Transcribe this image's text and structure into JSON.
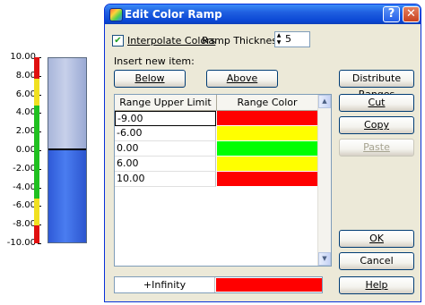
{
  "gauge": {
    "labels": [
      "10.00",
      "8.00",
      "6.00",
      "4.00",
      "2.00",
      "0.00",
      "-2.00",
      "-4.00",
      "-6.00",
      "-8.00",
      "-10.00"
    ],
    "level": 0.5,
    "colors": {
      "red": "#e01010",
      "yellow": "#f0e020",
      "green": "#20c020"
    }
  },
  "dialog": {
    "title": "Edit Color Ramp",
    "help_glyph": "?",
    "close_glyph": "✕",
    "interpolate_label": "Interpolate Colors",
    "interpolate_checked_glyph": "✔",
    "ramp_thickness_label": "Ramp Thickness:",
    "ramp_thickness_value": "5",
    "insert_label": "Insert new item:",
    "below_label": "Below",
    "above_label": "Above",
    "distribute_label": "Distribute Ranges",
    "cut_label": "Cut",
    "copy_label": "Copy",
    "paste_label": "Paste",
    "ok_label": "OK",
    "cancel_label": "Cancel",
    "help_label": "Help",
    "table": {
      "headers": [
        "Range Upper Limit",
        "Range Color"
      ],
      "rows": [
        {
          "value": "-9.00",
          "color": "#ff0000"
        },
        {
          "value": "-6.00",
          "color": "#ffff00"
        },
        {
          "value": "0.00",
          "color": "#00ff00"
        },
        {
          "value": "6.00",
          "color": "#ffff00"
        },
        {
          "value": "10.00",
          "color": "#ff0000"
        }
      ]
    },
    "infinity": {
      "label": "+Infinity",
      "color": "#ff0000"
    }
  }
}
